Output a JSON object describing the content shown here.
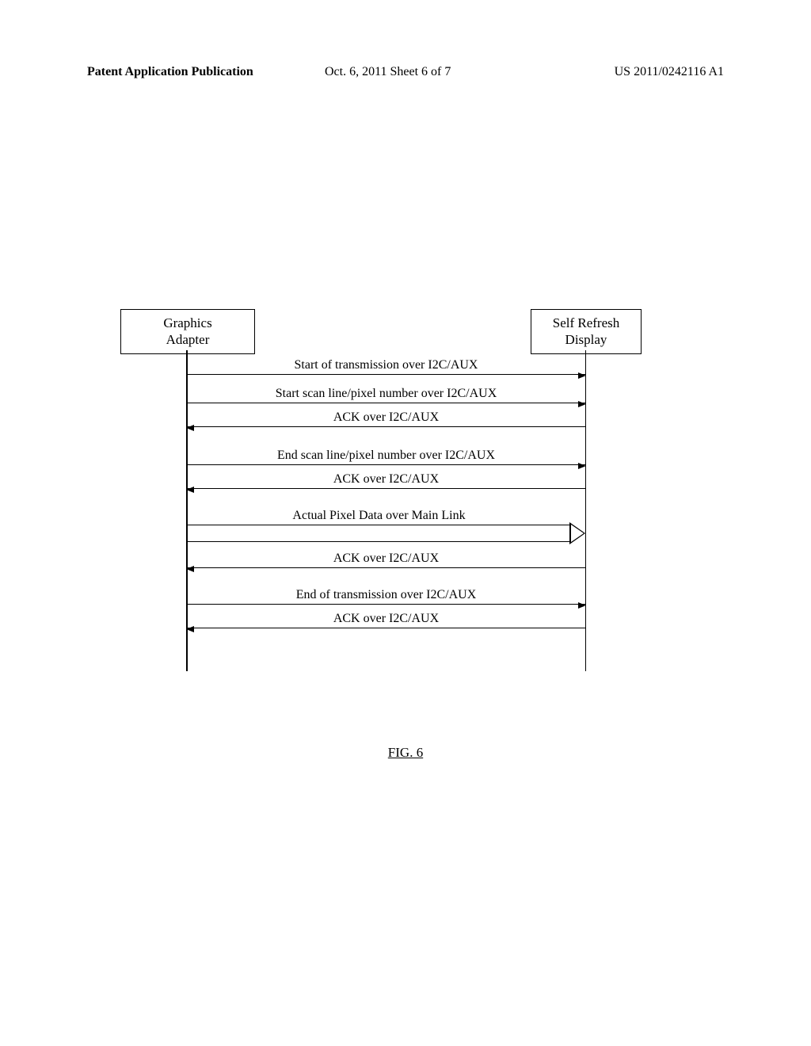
{
  "header": {
    "left": "Patent Application Publication",
    "mid": "Oct. 6, 2011  Sheet 6 of 7",
    "right": "US 2011/0242116 A1"
  },
  "boxes": {
    "left": "Graphics\nAdapter",
    "right": "Self Refresh\nDisplay"
  },
  "msgs": {
    "m1": "Start of transmission over I2C/AUX",
    "m2": "Start scan line/pixel number over I2C/AUX",
    "m3": "ACK over I2C/AUX",
    "m4": "End scan line/pixel number over I2C/AUX",
    "m5": "ACK over I2C/AUX",
    "m6": "Actual Pixel Data over Main Link",
    "m7": "ACK over I2C/AUX",
    "m8": "End of transmission over I2C/AUX",
    "m9": "ACK over I2C/AUX"
  },
  "figure": "FIG. 6"
}
